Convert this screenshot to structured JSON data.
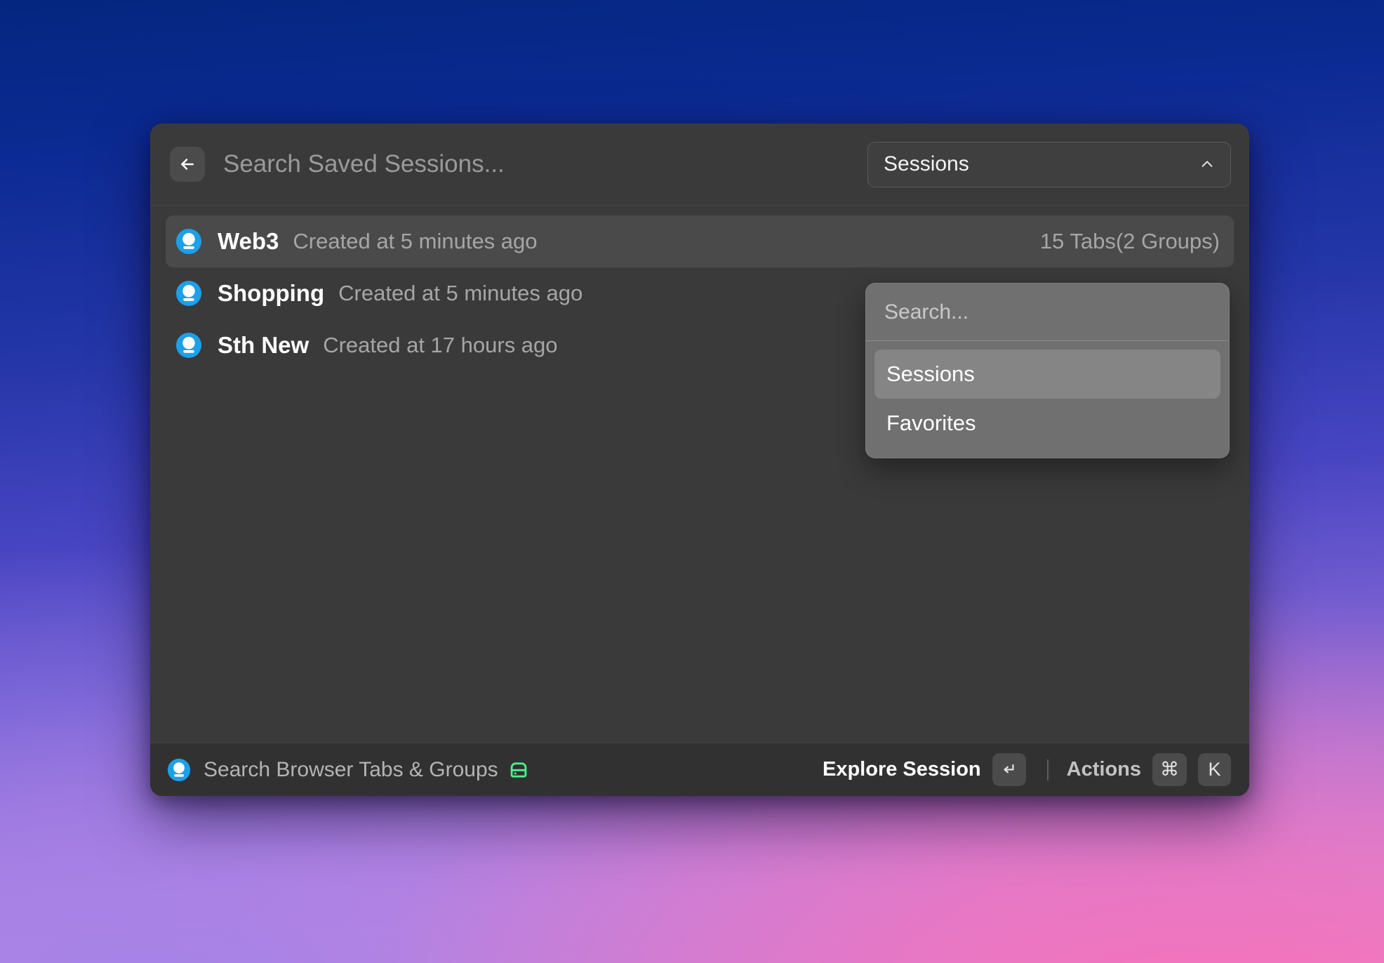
{
  "header": {
    "back_icon": "arrow-left-icon",
    "search_placeholder": "Search Saved Sessions...",
    "search_value": "",
    "scope_value": "Sessions",
    "scope_chevron_icon": "chevron-up-icon"
  },
  "dropdown": {
    "search_placeholder": "Search...",
    "search_value": "",
    "options": [
      {
        "label": "Sessions",
        "active": true
      },
      {
        "label": "Favorites",
        "active": false
      }
    ]
  },
  "sessions": [
    {
      "icon": "session-bulb-icon",
      "title": "Web3",
      "meta": "Created at 5 minutes ago",
      "tabs": "15 Tabs(2 Groups)",
      "selected": true
    },
    {
      "icon": "session-bulb-icon",
      "title": "Shopping",
      "meta": "Created at 5 minutes ago",
      "tabs": "",
      "selected": false
    },
    {
      "icon": "session-bulb-icon",
      "title": "Sth New",
      "meta": "Created at 17 hours ago",
      "tabs": "",
      "selected": false
    }
  ],
  "footer": {
    "brand_icon": "session-bulb-icon",
    "brand_label": "Search Browser Tabs & Groups",
    "save_icon": "hard-drive-icon",
    "explore_label": "Explore Session",
    "enter_key": "↵",
    "actions_label": "Actions",
    "command_key": "⌘",
    "k_key": "K"
  },
  "colors": {
    "window_bg": "#3a3a3a",
    "footer_bg": "#313131",
    "row_selected": "#4a4a4a",
    "accent_blue": "#1ca0e8",
    "accent_green": "#4ef08a",
    "text_primary": "#ffffff",
    "text_muted": "#a6a6a6"
  }
}
